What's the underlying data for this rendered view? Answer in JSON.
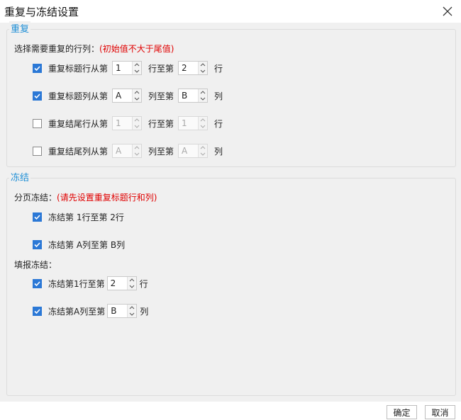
{
  "window": {
    "title": "重复与冻结设置"
  },
  "repeat": {
    "group_title": "重复",
    "prompt": "选择需要重复的行列：",
    "note": "(初始值不大于尾值)",
    "rows": [
      {
        "label": "重复标题行从第",
        "from": "1",
        "middle": "行至第",
        "to": "2",
        "unit": "行",
        "checked": true,
        "enabled": true
      },
      {
        "label": "重复标题列从第",
        "from": "A",
        "middle": "列至第",
        "to": "B",
        "unit": "列",
        "checked": true,
        "enabled": true
      },
      {
        "label": "重复结尾行从第",
        "from": "1",
        "middle": "行至第",
        "to": "1",
        "unit": "行",
        "checked": false,
        "enabled": false
      },
      {
        "label": "重复结尾列从第",
        "from": "A",
        "middle": "列至第",
        "to": "A",
        "unit": "列",
        "checked": false,
        "enabled": false
      }
    ]
  },
  "freeze": {
    "group_title": "冻结",
    "paging_label": "分页冻结：",
    "paging_note": "(请先设置重复标题行和列)",
    "paging_rows": [
      {
        "text": "冻结第 1行至第 2行",
        "checked": true
      },
      {
        "text": "冻结第 A列至第 B列",
        "checked": true
      }
    ],
    "fill_label": "填报冻结：",
    "fill_rows": [
      {
        "label": "冻结第1行至第",
        "value": "2",
        "unit": "行",
        "checked": true
      },
      {
        "label": "冻结第A列至第",
        "value": "B",
        "unit": "列",
        "checked": true
      }
    ]
  },
  "buttons": {
    "ok": "确定",
    "cancel": "取消"
  },
  "colors": {
    "accent": "#2b78d6",
    "group_title": "#1f8fd6",
    "note": "#e00000"
  }
}
